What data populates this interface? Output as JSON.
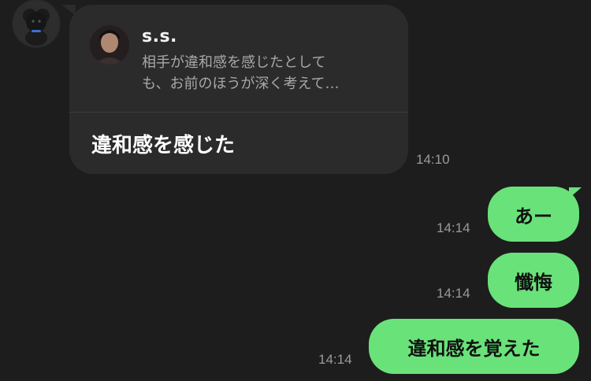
{
  "incoming": {
    "reply": {
      "name": "s.s.",
      "text": "相手が違和感を感じたとして\nも、お前のほうが深く考えて…"
    },
    "message": "違和感を感じた",
    "time": "14:10"
  },
  "outgoing": [
    {
      "text": "あー",
      "time": "14:14"
    },
    {
      "text": "懺悔",
      "time": "14:14"
    },
    {
      "text": "違和感を覚えた",
      "time": "14:14"
    }
  ],
  "colors": {
    "background": "#1d1d1d",
    "incoming_bubble": "#2b2b2b",
    "outgoing_bubble": "#6ae27a"
  }
}
